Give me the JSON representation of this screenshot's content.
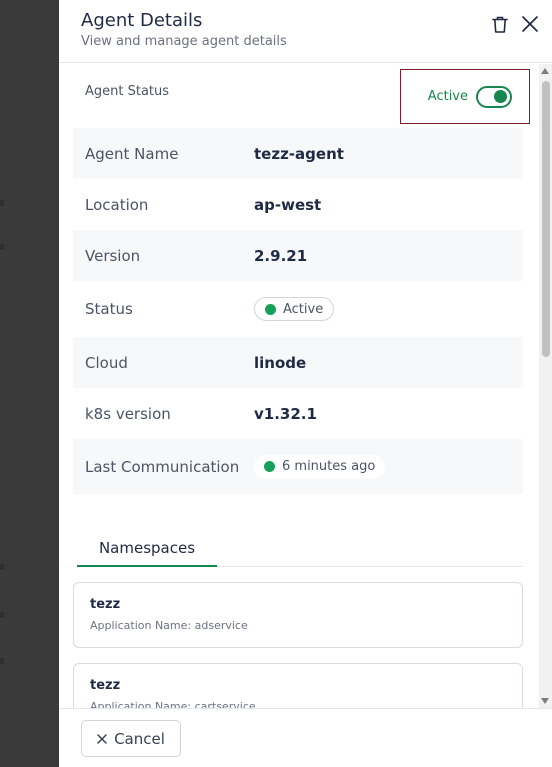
{
  "header": {
    "title": "Agent Details",
    "subtitle": "View and manage agent details",
    "delete_icon": "trash-icon",
    "close_icon": "close-icon"
  },
  "agent_status": {
    "label": "Agent Status",
    "toggle_label": "Active",
    "enabled": true
  },
  "details": {
    "rows": [
      {
        "key": "Agent Name",
        "value": "tezz-agent"
      },
      {
        "key": "Location",
        "value": "ap-west"
      },
      {
        "key": "Version",
        "value": "2.9.21"
      },
      {
        "key": "Status",
        "value": "Active"
      },
      {
        "key": "Cloud",
        "value": "linode"
      },
      {
        "key": "k8s version",
        "value": "v1.32.1"
      },
      {
        "key": "Last Communication",
        "value": "6 minutes ago"
      }
    ]
  },
  "tabs": [
    {
      "label": "Namespaces",
      "active": true
    }
  ],
  "namespaces": [
    {
      "name": "tezz",
      "application": "Application Name: adservice"
    },
    {
      "name": "tezz",
      "application": "Application Name: cartservice"
    }
  ],
  "footer": {
    "cancel_label": "Cancel"
  },
  "colors": {
    "accent": "#16874e",
    "status_dot": "#16a05a",
    "focus_outline": "#7a1e2e",
    "text_primary": "#1f2a44"
  }
}
